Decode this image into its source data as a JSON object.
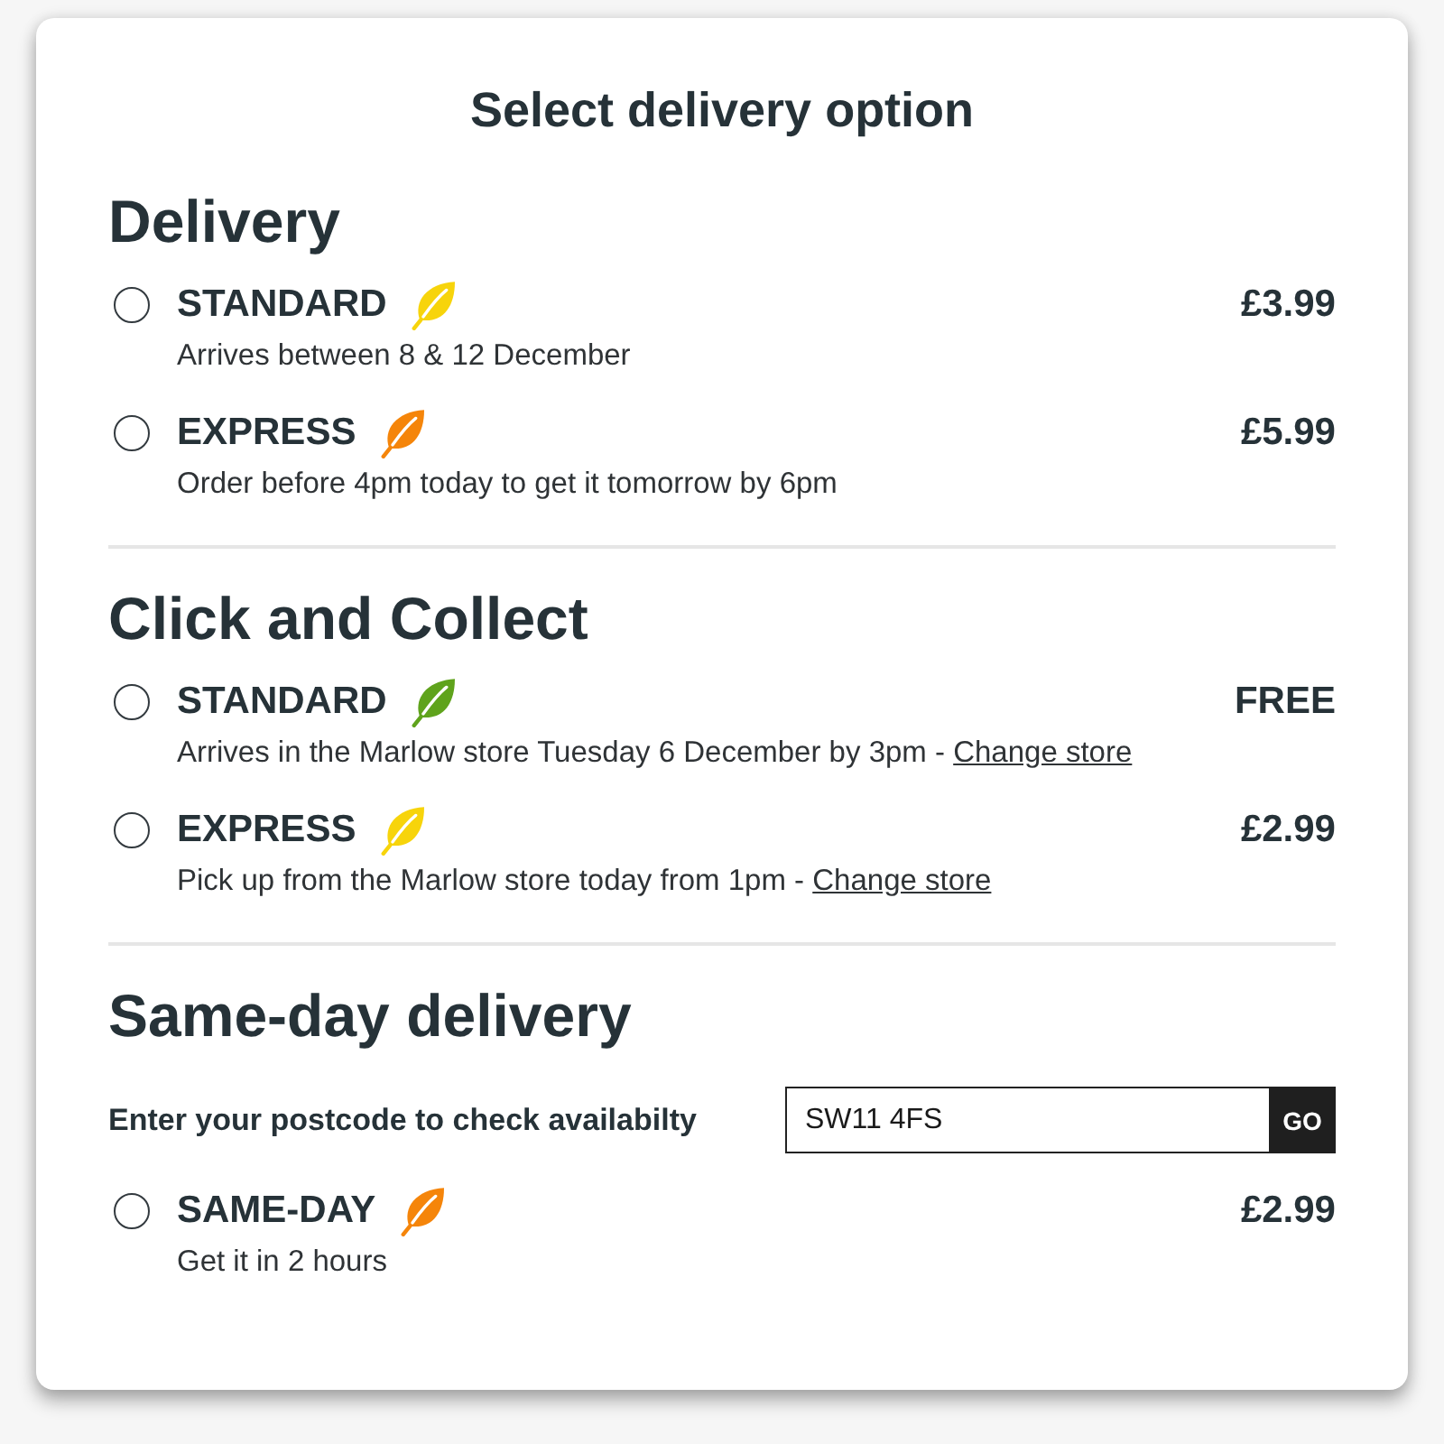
{
  "dialog": {
    "title": "Select delivery option"
  },
  "sections": [
    {
      "heading": "Delivery",
      "options": [
        {
          "name": "STANDARD",
          "color": "#f7d40b",
          "price": "£3.99",
          "description": "Arrives between 8 & 12 December",
          "selected": false
        },
        {
          "name": "EXPRESS",
          "color": "#f5850a",
          "price": "£5.99",
          "description": "Order before 4pm today to get it tomorrow by 6pm",
          "selected": false
        }
      ]
    },
    {
      "heading": "Click and Collect",
      "options": [
        {
          "name": "STANDARD",
          "color": "#5fa31c",
          "price": "FREE",
          "description": "Arrives in the Marlow store Tuesday 6 December by 3pm -",
          "link": "Change store",
          "selected": false
        },
        {
          "name": "EXPRESS",
          "color": "#f7d40b",
          "price": "£2.99",
          "description": "Pick up from the Marlow store today from 1pm -",
          "link": "Change store",
          "selected": false
        }
      ]
    },
    {
      "heading": "Same-day delivery",
      "postcode": {
        "label": "Enter your postcode to check availabilty",
        "value": "SW11 4FS",
        "button": "GO"
      },
      "options": [
        {
          "name": "SAME-DAY",
          "color": "#f5850a",
          "price": "£2.99",
          "description": "Get it in 2 hours",
          "selected": false
        }
      ]
    }
  ]
}
